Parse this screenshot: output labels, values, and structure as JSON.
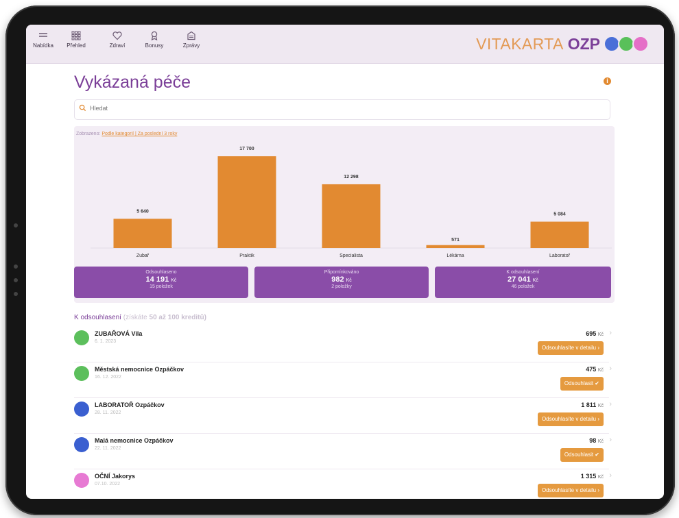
{
  "nav": {
    "items": [
      {
        "label": "Nabídka",
        "icon": "menu-icon"
      },
      {
        "label": "Přehled",
        "icon": "grid-icon"
      },
      {
        "label": "Zdraví",
        "icon": "heart-icon"
      },
      {
        "label": "Bonusy",
        "icon": "ribbon-icon"
      },
      {
        "label": "Zprávy",
        "icon": "inbox-icon"
      }
    ]
  },
  "brand": {
    "name_left": "VITAKARTA",
    "name_right": "OZP",
    "colors": {
      "vitakarta": "#e39a55",
      "ozp": "#7b3f98",
      "circle1": "#4a6fd8",
      "circle2": "#59c05a",
      "circle3": "#e56fc7"
    }
  },
  "page": {
    "title": "Vykázaná péče",
    "info_icon": "i",
    "search_placeholder": "Hledat"
  },
  "filter": {
    "prefix": "Zobrazeno:",
    "link": "Podle kategorií | Za poslední 3 roky"
  },
  "chart_data": {
    "type": "bar",
    "categories": [
      "Zubař",
      "Praktik",
      "Specialista",
      "Lékárna",
      "Laboratoř"
    ],
    "values": [
      5640,
      17700,
      12298,
      571,
      5084
    ],
    "value_labels": [
      "5 640",
      "17 700",
      "12 298",
      "571",
      "5 084"
    ],
    "ylim": [
      0,
      18500
    ],
    "color": "#e28a31"
  },
  "summary": [
    {
      "title": "Odsouhlaseno",
      "amount": "14 191",
      "currency": "Kč",
      "count": "15 položek"
    },
    {
      "title": "Připomínkováno",
      "amount": "982",
      "currency": "Kč",
      "count": "2 položky"
    },
    {
      "title": "K odsouhlasení",
      "amount": "27 041",
      "currency": "Kč",
      "count": "46 položek"
    }
  ],
  "section": {
    "title": "K odsouhlasení",
    "subtitle": "(získáte",
    "bonus": "50 až 100 kreditů)"
  },
  "records": [
    {
      "name": "ZUBAŘOVÁ Vila",
      "date": "6. 1. 2023",
      "amount": "695",
      "currency": "Kč",
      "button": "Odsouhlasíte v detailu ›",
      "avatar_color": "#5cbf5c",
      "avatar_icon": "tooth-icon"
    },
    {
      "name": "Městská nemocnice Ozpáčkov",
      "date": "16. 12. 2022",
      "amount": "475",
      "currency": "Kč",
      "button": "Odsouhlasit ✔",
      "avatar_color": "#5cbf5c",
      "avatar_icon": "stethoscope-icon"
    },
    {
      "name": "LABORATOŘ Ozpáčkov",
      "date": "28. 11. 2022",
      "amount": "1 811",
      "currency": "Kč",
      "button": "Odsouhlasíte v detailu ›",
      "avatar_color": "#3a5fd0",
      "avatar_icon": "flask-icon"
    },
    {
      "name": "Malá nemocnice Ozpáčkov",
      "date": "22. 11. 2022",
      "amount": "98",
      "currency": "Kč",
      "button": "Odsouhlasit ✔",
      "avatar_color": "#3a5fd0",
      "avatar_icon": "hospital-icon"
    },
    {
      "name": "OČNÍ Jakorys",
      "date": "07.10. 2022",
      "amount": "1 315",
      "currency": "Kč",
      "button": "Odsouhlasíte v detailu ›",
      "avatar_color": "#e77ad3",
      "avatar_icon": "eye-icon"
    }
  ]
}
